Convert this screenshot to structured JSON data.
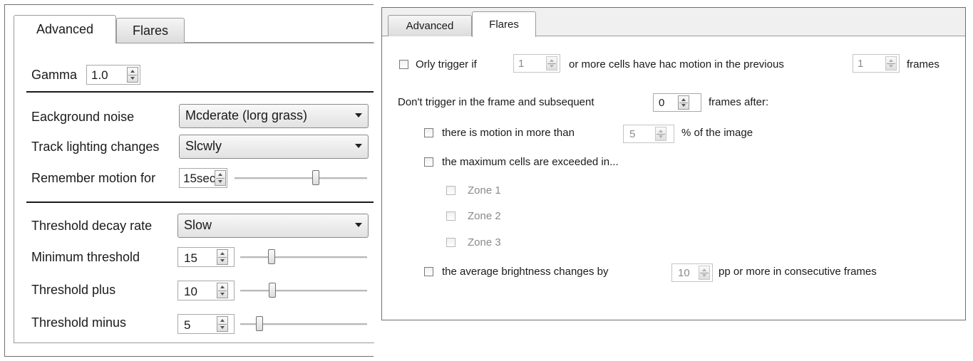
{
  "left": {
    "tabs": [
      {
        "label": "Advanced",
        "active": true
      },
      {
        "label": "Flares",
        "active": false
      }
    ],
    "gamma": {
      "label": "Gamma",
      "value": "1.0"
    },
    "background_noise": {
      "label": "Eackground noise",
      "value": "Mcderate (lorg grass)"
    },
    "track_lighting": {
      "label": "Track lighting changes",
      "value": "Slcwly"
    },
    "remember_motion": {
      "label": "Remember motion for",
      "value": "15sec",
      "slider_level": 0.62
    },
    "threshold_decay": {
      "label": "Threshold decay rate",
      "value": "Slow"
    },
    "min_threshold": {
      "label": "Minimum threshold",
      "value": "15",
      "slider_level": 0.23
    },
    "threshold_plus": {
      "label": "Threshold plus",
      "value": "10",
      "slider_level": 0.24
    },
    "threshold_minus": {
      "label": "Threshold minus",
      "value": "5",
      "slider_level": 0.13
    }
  },
  "right": {
    "tabs": [
      {
        "label": "Advanced",
        "active": false
      },
      {
        "label": "Flares",
        "active": true
      }
    ],
    "only_trigger": {
      "prefix": "Orly trigger if",
      "cells_value": "1",
      "middle": "or more cells have hac motion in the previous",
      "frames_value": "1",
      "suffix": "frames"
    },
    "dont_trigger": {
      "prefix": "Don't trigger in the frame and subsequent",
      "value": "0",
      "suffix": "frames after:"
    },
    "motion_more_than": {
      "prefix": "there is motion in more than",
      "value": "5",
      "suffix": "% of the image"
    },
    "max_cells": {
      "label": "the maximum cells are exceeded in..."
    },
    "zones": [
      "Zone 1",
      "Zone 2",
      "Zone 3"
    ],
    "brightness": {
      "prefix": "the average brightness changes by",
      "value": "10",
      "suffix": "pp or more in consecutive frames"
    }
  }
}
